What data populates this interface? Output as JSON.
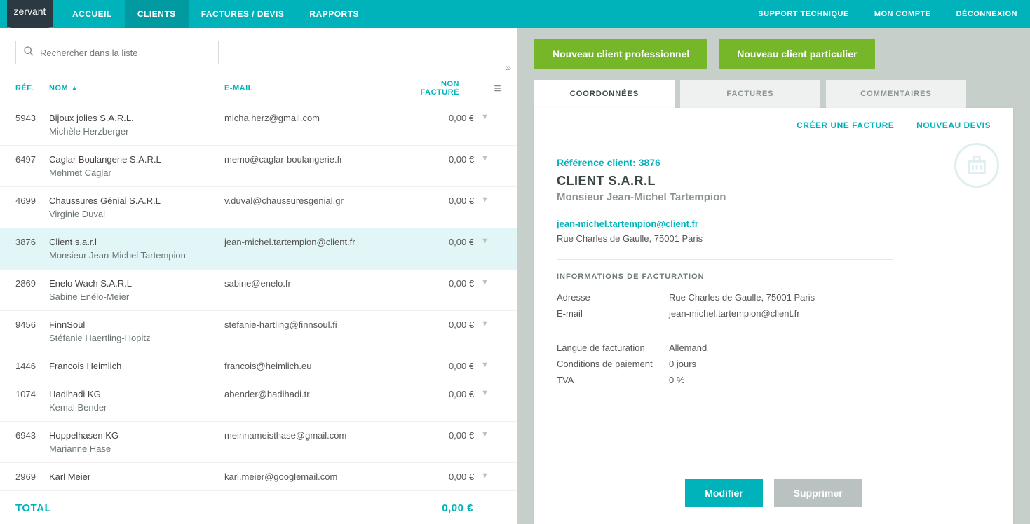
{
  "brand": "zervant",
  "nav": {
    "home": "ACCUEIL",
    "clients": "CLIENTS",
    "invoices": "FACTURES / DEVIS",
    "reports": "RAPPORTS",
    "support": "SUPPORT TECHNIQUE",
    "account": "MON COMPTE",
    "logout": "DÉCONNEXION"
  },
  "search": {
    "placeholder": "Rechercher dans la liste"
  },
  "columns": {
    "ref": "RÉF.",
    "nom": "NOM",
    "email": "E-MAIL",
    "unbilled": "NON FACTURÉ"
  },
  "clients": [
    {
      "ref": "5943",
      "name": "Bijoux jolies S.A.R.L.",
      "person": "Michèle Herzberger",
      "email": "micha.herz@gmail.com",
      "amount": "0,00 €"
    },
    {
      "ref": "6497",
      "name": "Caglar Boulangerie S.A.R.L",
      "person": "Mehmet Caglar",
      "email": "memo@caglar-boulangerie.fr",
      "amount": "0,00 €"
    },
    {
      "ref": "4699",
      "name": "Chaussures Génial S.A.R.L",
      "person": "Virginie Duval",
      "email": "v.duval@chaussuresgenial.gr",
      "amount": "0,00 €"
    },
    {
      "ref": "3876",
      "name": "Client s.a.r.l",
      "person": "Monsieur Jean-Michel Tartempion",
      "email": "jean-michel.tartempion@client.fr",
      "amount": "0,00 €"
    },
    {
      "ref": "2869",
      "name": "Enelo Wach S.A.R.L",
      "person": "Sabine Enélo-Meier",
      "email": "sabine@enelo.fr",
      "amount": "0,00 €"
    },
    {
      "ref": "9456",
      "name": "FinnSoul",
      "person": "Stéfanie Haertling-Hopitz",
      "email": "stefanie-hartling@finnsoul.fi",
      "amount": "0,00 €"
    },
    {
      "ref": "1446",
      "name": "Francois Heimlich",
      "person": "",
      "email": "francois@heimlich.eu",
      "amount": "0,00 €"
    },
    {
      "ref": "1074",
      "name": "Hadihadi KG",
      "person": "Kemal Bender",
      "email": "abender@hadihadi.tr",
      "amount": "0,00 €"
    },
    {
      "ref": "6943",
      "name": "Hoppelhasen KG",
      "person": "Marianne Hase",
      "email": "meinnameisthase@gmail.com",
      "amount": "0,00 €"
    },
    {
      "ref": "2969",
      "name": "Karl Meier",
      "person": "",
      "email": "karl.meier@googlemail.com",
      "amount": "0,00 €"
    }
  ],
  "total": {
    "label": "TOTAL",
    "value": "0,00 €"
  },
  "rightButtons": {
    "newPro": "Nouveau client professionnel",
    "newPart": "Nouveau client particulier"
  },
  "tabs": {
    "coords": "COORDONNÉES",
    "invoices": "FACTURES",
    "comments": "COMMENTAIRES"
  },
  "detailActions": {
    "createInvoice": "CRÉER UNE FACTURE",
    "newQuote": "NOUVEAU DEVIS"
  },
  "detail": {
    "refLabel": "Référence client: 3876",
    "company": "CLIENT S.A.R.L",
    "contact": "Monsieur Jean-Michel Tartempion",
    "email": "jean-michel.tartempion@client.fr",
    "address": "Rue Charles de Gaulle, 75001 Paris",
    "billingTitle": "INFORMATIONS DE FACTURATION",
    "rows": {
      "addressLabel": "Adresse",
      "addressVal": "Rue Charles de Gaulle, 75001 Paris",
      "emailLabel": "E-mail",
      "emailVal": "jean-michel.tartempion@client.fr",
      "langLabel": "Langue de facturation",
      "langVal": "Allemand",
      "termsLabel": "Conditions de paiement",
      "termsVal": "0 jours",
      "vatLabel": "TVA",
      "vatVal": "0 %"
    }
  },
  "buttons": {
    "modify": "Modifier",
    "delete": "Supprimer"
  }
}
